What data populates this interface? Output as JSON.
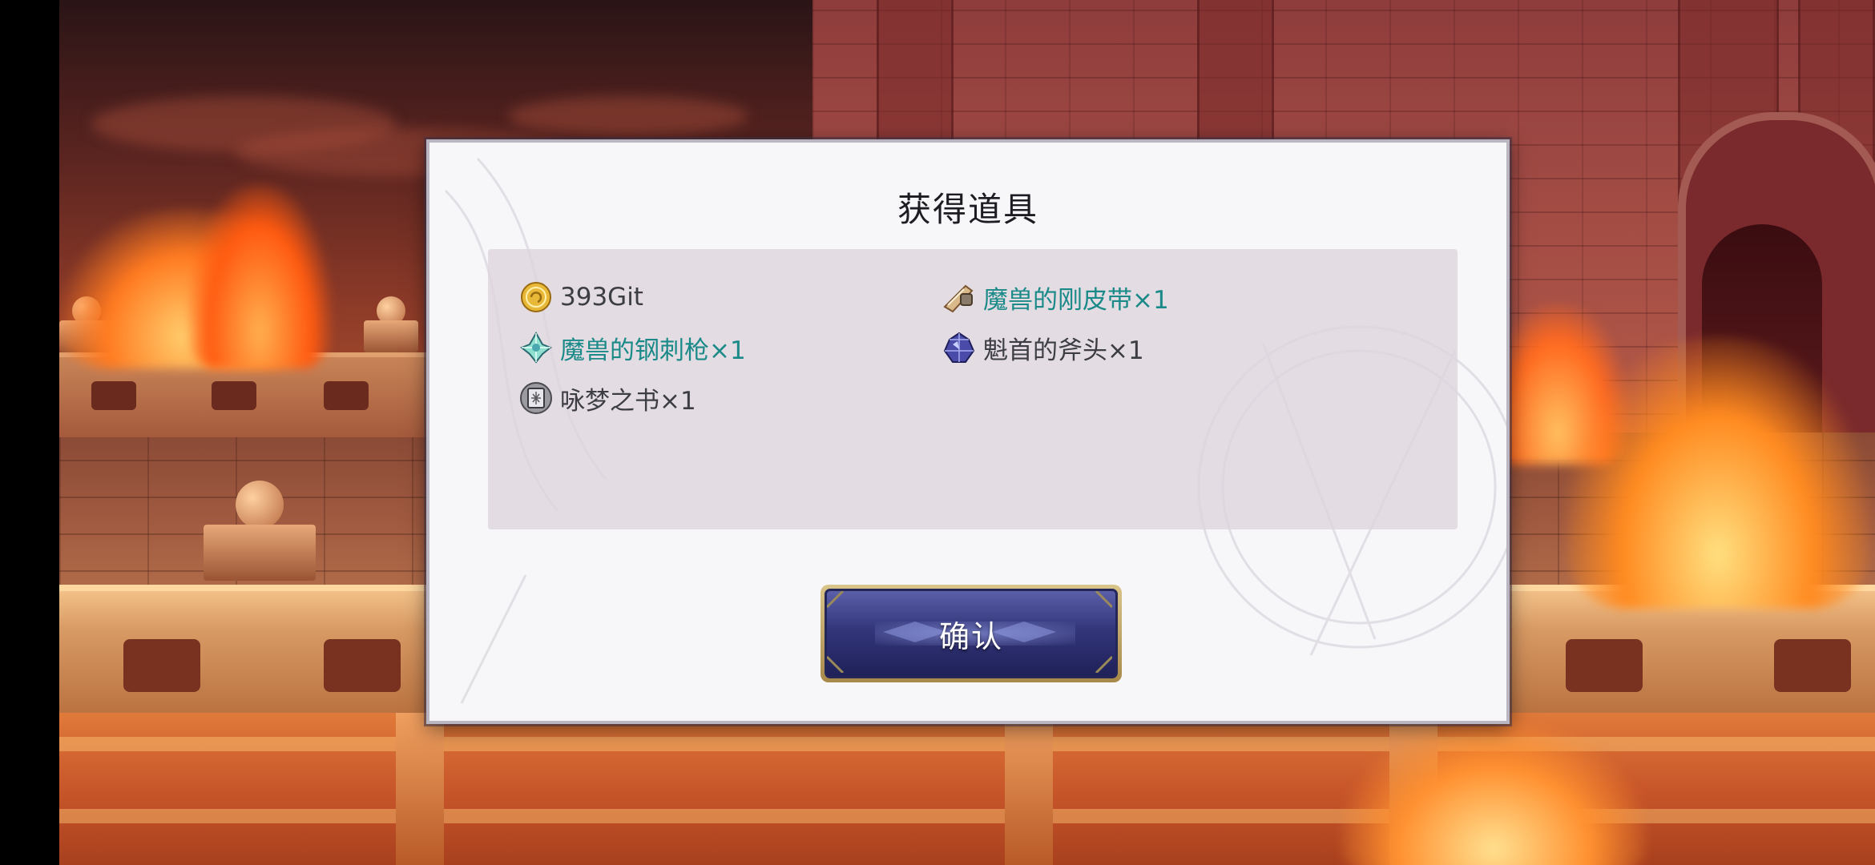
{
  "dialog": {
    "title": "获得道具",
    "confirm_label": "确认"
  },
  "items": [
    {
      "label": "393Git",
      "rarity": "normal",
      "icon": "gold-coin-icon"
    },
    {
      "label": "魔兽的刚皮带×1",
      "rarity": "rare",
      "icon": "leather-belt-icon"
    },
    {
      "label": "魔兽的钢刺枪×1",
      "rarity": "rare",
      "icon": "green-crystal-icon"
    },
    {
      "label": "魁首的斧头×1",
      "rarity": "normal",
      "icon": "blue-crystal-icon"
    },
    {
      "label": "咏梦之书×1",
      "rarity": "normal",
      "icon": "book-icon"
    }
  ],
  "colors": {
    "rare_text": "#1a8a88",
    "normal_text": "#3d3d44",
    "dialog_bg": "#f7f6f9",
    "button_bg": "#33367a",
    "button_border": "#c8b070"
  }
}
